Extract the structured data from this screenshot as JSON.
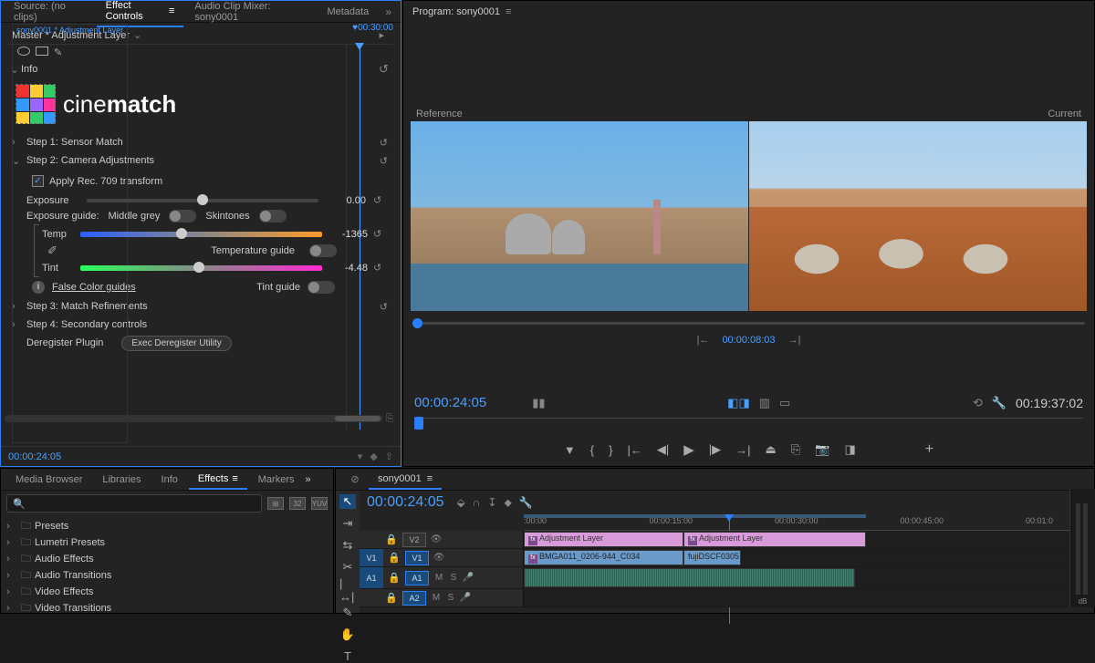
{
  "sourceTabs": {
    "source": "Source: (no clips)",
    "effectControls": "Effect Controls",
    "audioMixer": "Audio Clip Mixer: sony0001",
    "metadata": "Metadata"
  },
  "effectControls": {
    "master": "Master * Adjustment Layer",
    "clip": "sony0001 * Adjustment Layer",
    "rulerTc": "00:30:00",
    "info": "Info",
    "logo1": "cine",
    "logo2": "match",
    "steps": {
      "s1": "Step 1: Sensor Match",
      "s2": "Step 2: Camera Adjustments",
      "s3": "Step 3: Match Refinements",
      "s4": "Step 4: Secondary controls",
      "dereg": "Deregister Plugin",
      "deregBtn": "Exec Deregister Utility"
    },
    "apply709": "Apply Rec. 709 transform",
    "exposure": {
      "label": "Exposure",
      "value": "0.00"
    },
    "expGuide": "Exposure guide:",
    "midGrey": "Middle grey",
    "skintones": "Skintones",
    "temp": {
      "label": "Temp",
      "value": "-1365"
    },
    "tempGuide": "Temperature guide",
    "tint": {
      "label": "Tint",
      "value": "-4.48"
    },
    "tintGuide": "Tint guide",
    "falseColor": "False Color guides",
    "footTc": "00:00:24:05"
  },
  "program": {
    "title": "Program: sony0001",
    "reference": "Reference",
    "current": "Current",
    "miniTc": "00:00:08:03",
    "barTc": "00:00:24:05",
    "durTc": "00:19:37:02"
  },
  "bottomLeft": {
    "tabs": {
      "media": "Media Browser",
      "libs": "Libraries",
      "info": "Info",
      "effects": "Effects",
      "markers": "Markers"
    },
    "searchPlaceholder": "",
    "tree": [
      "Presets",
      "Lumetri Presets",
      "Audio Effects",
      "Audio Transitions",
      "Video Effects",
      "Video Transitions"
    ]
  },
  "timeline": {
    "seq": "sony0001",
    "tc": "00:00:24:05",
    "ruler": [
      ":00:00",
      "00:00:15:00",
      "00:00:30:00",
      "00:00:45:00",
      "00:01:0"
    ],
    "tracks": {
      "v2": "V2",
      "v1": "V1",
      "a1": "A1",
      "a2": "A2"
    },
    "clips": {
      "adj1": "Adjustment Layer",
      "adj2": "Adjustment Layer",
      "vid1": "BMGA011_0206-944_C034",
      "vid2": "fujiDSCF0305"
    }
  },
  "meters": {
    "db": "dB"
  }
}
